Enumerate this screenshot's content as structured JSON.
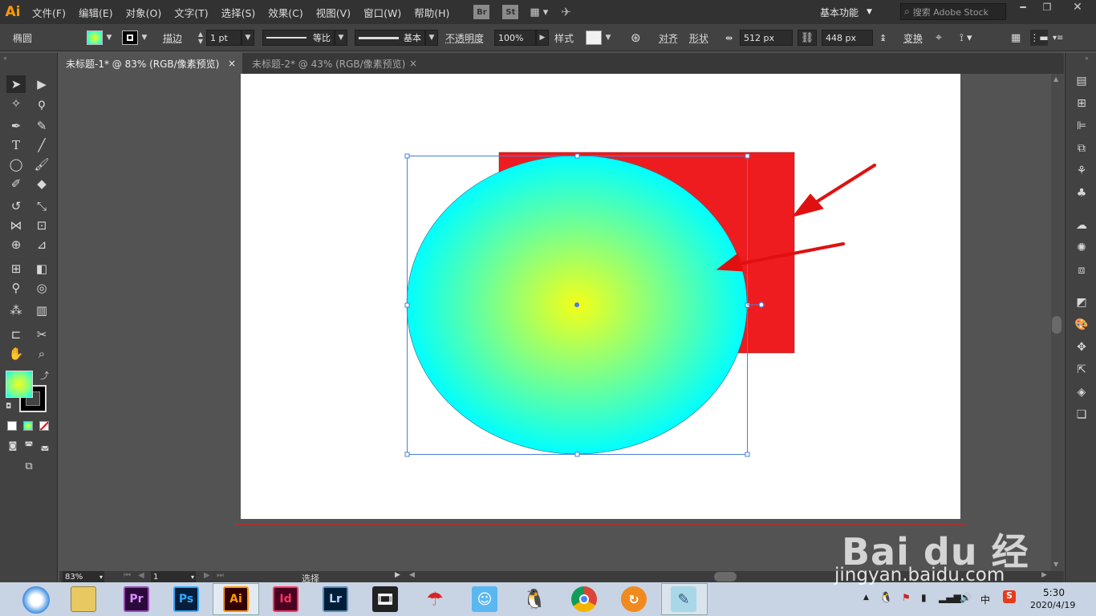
{
  "app": {
    "logo": "Ai"
  },
  "menus": [
    "文件(F)",
    "编辑(E)",
    "对象(O)",
    "文字(T)",
    "选择(S)",
    "效果(C)",
    "视图(V)",
    "窗口(W)",
    "帮助(H)"
  ],
  "menubar_right": {
    "br": "Br",
    "st": "St",
    "workspace": "基本功能",
    "search_placeholder": "搜索 Adobe Stock"
  },
  "control": {
    "object_type": "椭圆",
    "stroke_label": "描边",
    "stroke_weight": "1 pt",
    "profile_label": "等比",
    "brush_label": "基本",
    "opacity_label": "不透明度",
    "opacity_value": "100%",
    "style_label": "样式",
    "align_label": "对齐",
    "shape_label": "形状",
    "width_value": "512 px",
    "height_value": "448 px",
    "transform_label": "变换"
  },
  "tabs": [
    {
      "title": "未标题-1* @ 83% (RGB/像素预览)",
      "close": "×",
      "active": true
    },
    {
      "title": "未标题-2* @ 43% (RGB/像素预览)",
      "close": "×",
      "active": false
    }
  ],
  "status": {
    "zoom": "83%",
    "page": "1",
    "tool": "选择"
  },
  "artwork": {
    "rect_color": "#ee1c1f",
    "gradient_center": "#f3ff18",
    "gradient_edge": "#00ffff",
    "arrow_color": "#e01010"
  },
  "watermark": {
    "brand": "Bai du 经验",
    "url": "jingyan.baidu.com"
  },
  "taskbar": {
    "apps": [
      "Pr",
      "Ps",
      "Ai",
      "Id",
      "Lr"
    ],
    "tray_lang": "中",
    "time": "5:30",
    "date": "2020/4/19"
  }
}
